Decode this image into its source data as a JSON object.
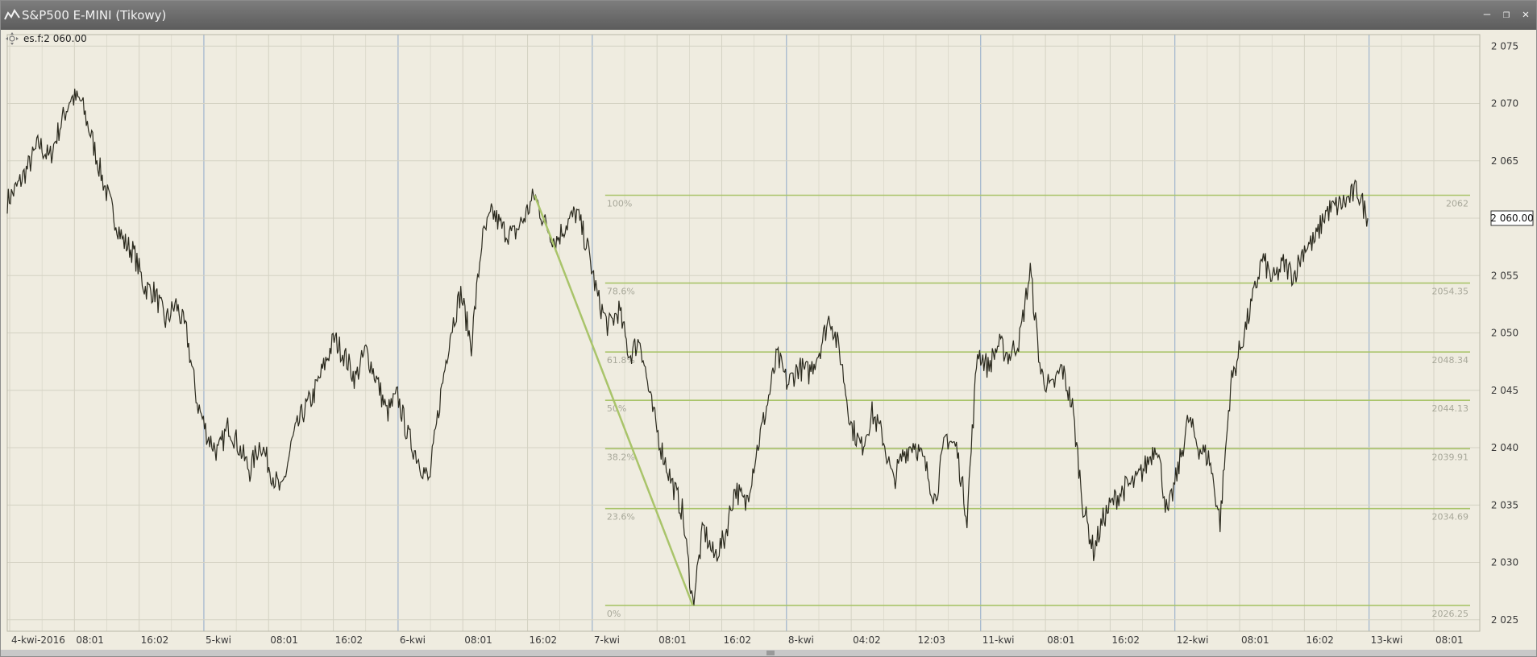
{
  "window": {
    "title": "S&P500 E-MINI (Tikowy)",
    "minimize": "–",
    "restore": "❐",
    "close": "✕"
  },
  "legend": {
    "label": "es.f:2 060.00",
    "icon": "move-icon"
  },
  "colors": {
    "background": "#efece0",
    "grid": "#d4d2c3",
    "session": "#8fa9c9",
    "price": "#2b2a1e",
    "fib": "#a9c46a",
    "fib_label": "#a8a89a",
    "axis_text": "#3a3a3a"
  },
  "chart_data": {
    "type": "line",
    "title": "",
    "y_ticks": [
      2025,
      2030,
      2035,
      2040,
      2045,
      2050,
      2055,
      2060,
      2065,
      2070,
      2075
    ],
    "y_tick_labels": [
      "2 025",
      "2 030",
      "2 035",
      "2 040",
      "2 045",
      "2 050",
      "2 055",
      "2 060",
      "2 065",
      "2 070",
      "2 075"
    ],
    "ylim": [
      2024,
      2076
    ],
    "x_labels": [
      "4-kwi-2016",
      "08:01",
      "16:02",
      "5-kwi",
      "08:01",
      "16:02",
      "6-kwi",
      "08:01",
      "16:02",
      "7-kwi",
      "08:01",
      "16:02",
      "8-kwi",
      "04:02",
      "12:03",
      "11-kwi",
      "08:01",
      "16:02",
      "12-kwi",
      "08:01",
      "16:02",
      "13-kwi",
      "08:01"
    ],
    "session_labels": [
      "4-kwi-2016",
      "5-kwi",
      "6-kwi",
      "7-kwi",
      "8-kwi",
      "11-kwi",
      "12-kwi",
      "13-kwi"
    ],
    "current_price_label": "2 060.00",
    "current_price": 2060.0,
    "series": [
      {
        "values": [
          2061.5,
          2062.8,
          2064.5,
          2066.5,
          2065.2,
          2068.0,
          2070.5,
          2070.2,
          2067.0,
          2063.5,
          2060.5,
          2058.0,
          2057.0,
          2054.0,
          2053.5,
          2051.0,
          2052.5,
          2050.0,
          2044.0,
          2041.0,
          2039.5,
          2042.0,
          2040.0,
          2038.0,
          2040.5,
          2038.0,
          2036.0,
          2040.5,
          2043.0,
          2044.5,
          2047.0,
          2049.5,
          2048.0,
          2046.0,
          2048.5,
          2046.0,
          2043.0,
          2044.5,
          2041.0,
          2039.0,
          2037.0,
          2044.0,
          2050.0,
          2053.5,
          2049.0,
          2058.0,
          2060.5,
          2059.0,
          2058.5,
          2060.0,
          2062.0,
          2059.5,
          2058.0,
          2059.5,
          2060.5,
          2057.5,
          2053.0,
          2050.5,
          2052.0,
          2048.0,
          2049.5,
          2044.0,
          2040.0,
          2037.0,
          2034.5,
          2026.5,
          2033.0,
          2030.5,
          2032.0,
          2036.5,
          2035.0,
          2039.5,
          2043.5,
          2048.0,
          2045.5,
          2047.0,
          2046.5,
          2048.5,
          2051.5,
          2048.0,
          2042.0,
          2040.0,
          2043.0,
          2041.0,
          2037.0,
          2039.5,
          2040.5,
          2038.5,
          2035.5,
          2041.0,
          2040.0,
          2034.0,
          2048.5,
          2047.0,
          2049.0,
          2048.0,
          2049.5,
          2055.5,
          2046.5,
          2045.0,
          2047.0,
          2043.5,
          2035.0,
          2031.0,
          2034.0,
          2035.5,
          2036.5,
          2037.0,
          2038.5,
          2040.5,
          2034.0,
          2038.0,
          2042.5,
          2040.0,
          2039.0,
          2033.5,
          2045.5,
          2049.0,
          2052.5,
          2056.5,
          2054.5,
          2056.0,
          2055.0,
          2057.5,
          2058.0,
          2060.5,
          2061.0,
          2061.5,
          2062.5,
          2060.0
        ]
      }
    ],
    "fibonacci": {
      "high": 2062,
      "low": 2026.25,
      "levels": [
        {
          "pct_label": "100%",
          "price": 2062,
          "price_label": "2062"
        },
        {
          "pct_label": "78.6%",
          "price": 2054.35,
          "price_label": "2054.35"
        },
        {
          "pct_label": "61.8%",
          "price": 2048.34,
          "price_label": "2048.34"
        },
        {
          "pct_label": "50%",
          "price": 2044.13,
          "price_label": "2044.13"
        },
        {
          "pct_label": "38.2%",
          "price": 2039.91,
          "price_label": "2039.91"
        },
        {
          "pct_label": "23.6%",
          "price": 2034.69,
          "price_label": "2034.69"
        },
        {
          "pct_label": "0%",
          "price": 2026.25,
          "price_label": "2026.25"
        }
      ]
    },
    "grid": true
  }
}
